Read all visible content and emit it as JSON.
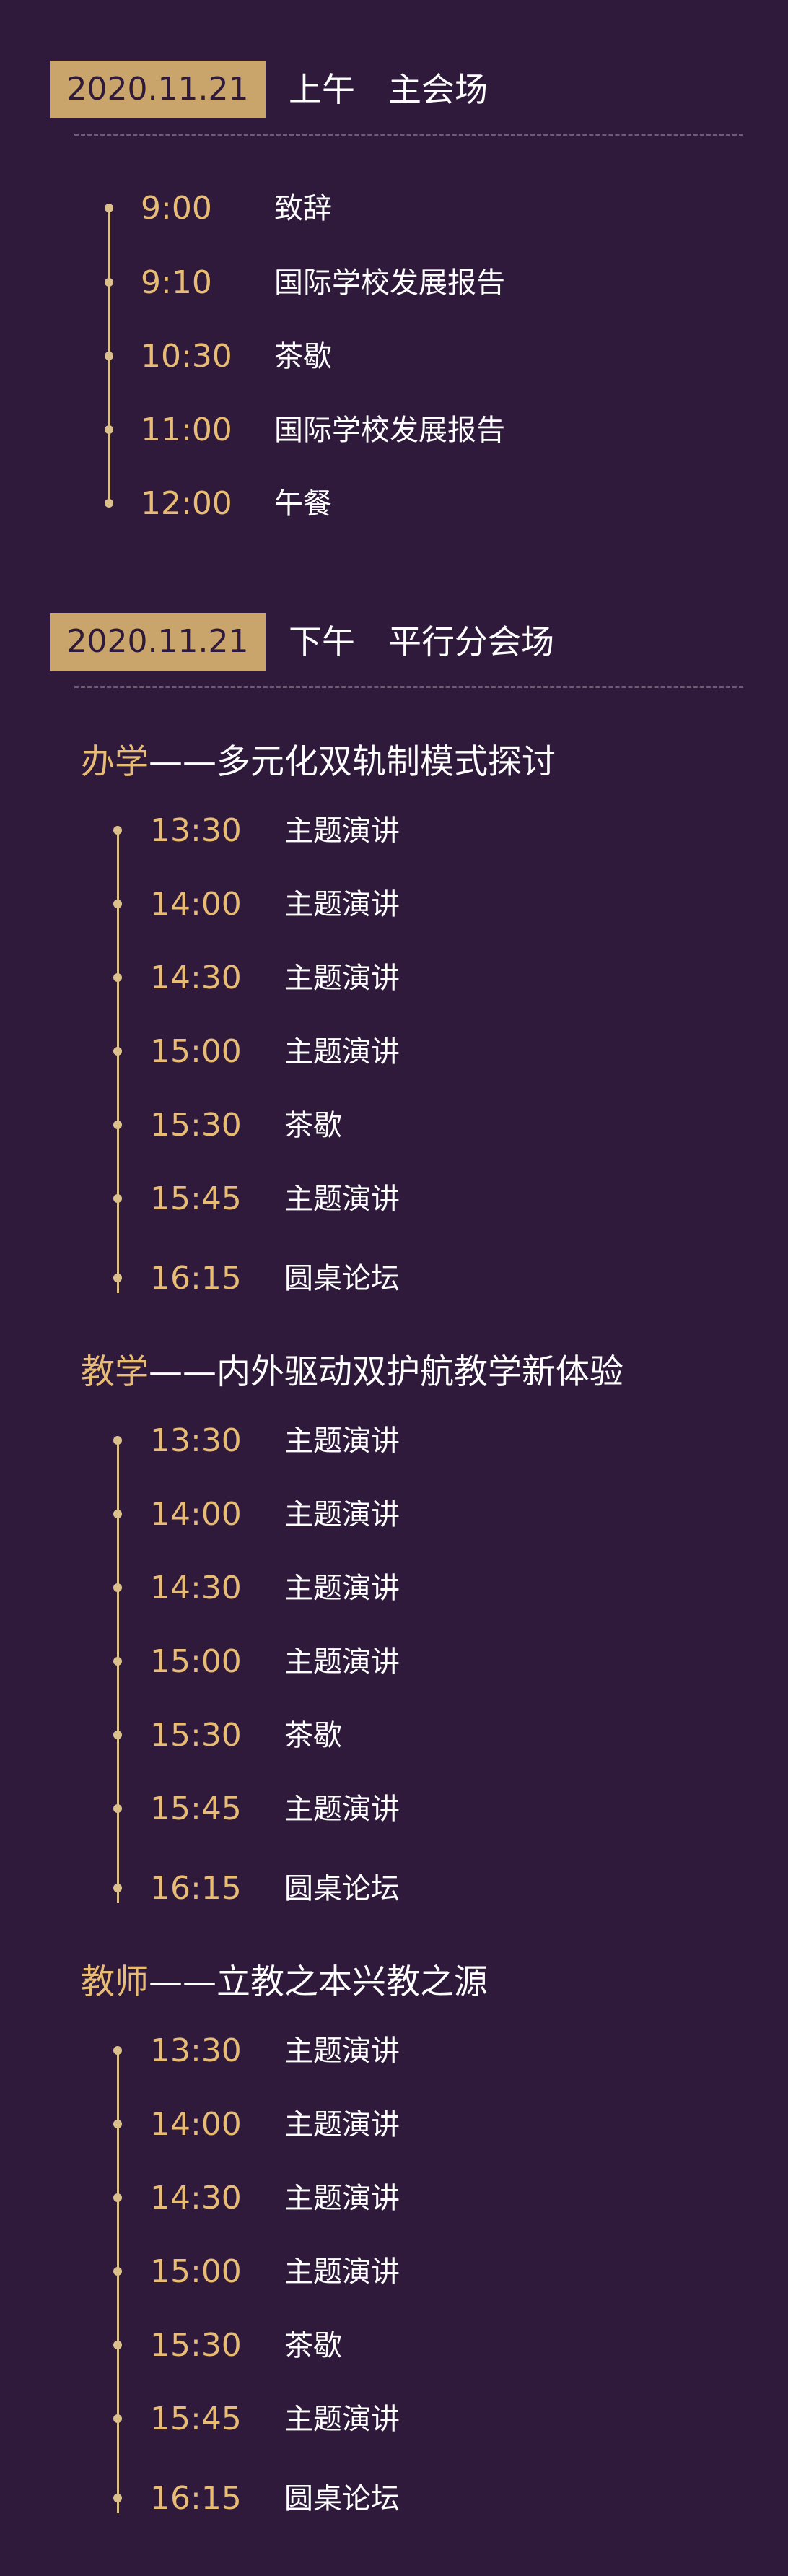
{
  "morning": {
    "date": "2020.11.21",
    "title": "上午　主会场",
    "items": [
      {
        "time": "9:00",
        "event": "致辞"
      },
      {
        "time": "9:10",
        "event": "国际学校发展报告"
      },
      {
        "time": "10:30",
        "event": "茶歇"
      },
      {
        "time": "11:00",
        "event": "国际学校发展报告"
      },
      {
        "time": "12:00",
        "event": "午餐"
      }
    ]
  },
  "afternoon": {
    "date": "2020.11.21",
    "title": "下午　平行分会场",
    "tracks": [
      {
        "tag": "办学",
        "title": "——多元化双轨制模式探讨",
        "items": [
          {
            "time": "13:30",
            "event": "主题演讲"
          },
          {
            "time": "14:00",
            "event": "主题演讲"
          },
          {
            "time": "14:30",
            "event": "主题演讲"
          },
          {
            "time": "15:00",
            "event": "主题演讲"
          },
          {
            "time": "15:30",
            "event": "茶歇"
          },
          {
            "time": "15:45",
            "event": "主题演讲"
          },
          {
            "time": "16:15",
            "event": "圆桌论坛"
          }
        ]
      },
      {
        "tag": "教学",
        "title": "——内外驱动双护航教学新体验",
        "items": [
          {
            "time": "13:30",
            "event": "主题演讲"
          },
          {
            "time": "14:00",
            "event": "主题演讲"
          },
          {
            "time": "14:30",
            "event": "主题演讲"
          },
          {
            "time": "15:00",
            "event": "主题演讲"
          },
          {
            "time": "15:30",
            "event": "茶歇"
          },
          {
            "time": "15:45",
            "event": "主题演讲"
          },
          {
            "time": "16:15",
            "event": "圆桌论坛"
          }
        ]
      },
      {
        "tag": "教师",
        "title": "——立教之本兴教之源",
        "items": [
          {
            "time": "13:30",
            "event": "主题演讲"
          },
          {
            "time": "14:00",
            "event": "主题演讲"
          },
          {
            "time": "14:30",
            "event": "主题演讲"
          },
          {
            "time": "15:00",
            "event": "主题演讲"
          },
          {
            "time": "15:30",
            "event": "茶歇"
          },
          {
            "time": "15:45",
            "event": "主题演讲"
          },
          {
            "time": "16:15",
            "event": "圆桌论坛"
          }
        ]
      }
    ]
  },
  "colors": {
    "background": "#2f1a3b",
    "gold": "#c9a46b",
    "time": "#e8bc74"
  }
}
